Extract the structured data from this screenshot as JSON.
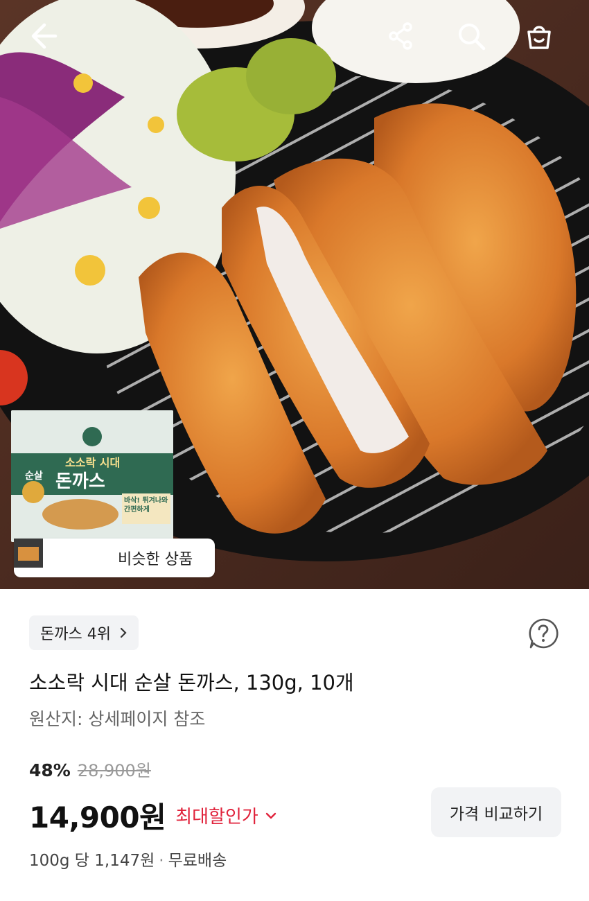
{
  "header": {
    "back_icon": "back-arrow-icon",
    "share_icon": "share-icon",
    "search_icon": "search-icon",
    "cart_icon": "shopping-bag-icon"
  },
  "hero": {
    "similar_products_label": "비슷한 상품",
    "package": {
      "brand": "소소락 시대",
      "line1": "순살",
      "name": "돈까스",
      "badge": "바삭! 튀겨나와 간편하게"
    }
  },
  "product": {
    "rank_label": "돈까스 4위",
    "title": "소소락 시대 순살 돈까스, 130g, 10개",
    "origin": "원산지: 상세페이지 참조",
    "discount_rate": "48%",
    "original_price": "28,900원",
    "sale_price": "14,900원",
    "max_discount_label": "최대할인가",
    "compare_button": "가격 비교하기",
    "unit_price": "100g 당 1,147원",
    "shipping": "무료배송"
  },
  "colors": {
    "accent_red": "#e0223b",
    "chip_bg": "#f2f3f5"
  }
}
